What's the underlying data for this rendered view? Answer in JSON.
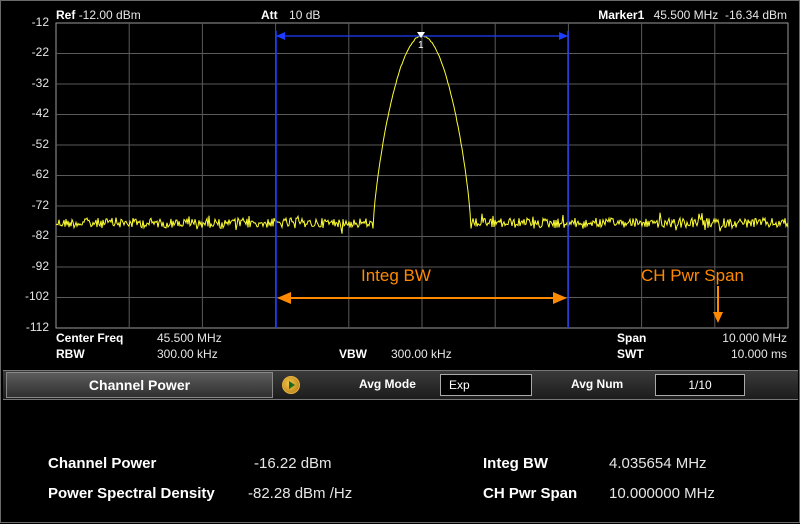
{
  "header": {
    "ref_key": "Ref",
    "ref_value": "-12.00 dBm",
    "att_key": "Att",
    "att_value": "10 dB",
    "marker_key": "Marker1",
    "marker_value": "45.500 MHz  -16.34 dBm"
  },
  "y_axis": {
    "ticks": [
      "-12",
      "-22",
      "-32",
      "-42",
      "-52",
      "-62",
      "-72",
      "-82",
      "-92",
      "-102",
      "-112"
    ]
  },
  "plot": {
    "marker_label": "1",
    "integ_bw_label": "Integ BW",
    "ch_pwr_span_label": "CH Pwr Span",
    "colors": {
      "trace": "#ffff33",
      "grid": "#5a5a5a",
      "integ_lines": "#1e3cff",
      "annotation": "#ff8a00"
    }
  },
  "footer": {
    "center_freq_key": "Center Freq",
    "center_freq_value": "45.500 MHz",
    "rbw_key": "RBW",
    "rbw_value": "300.00 kHz",
    "vbw_key": "VBW",
    "vbw_value": "300.00 kHz",
    "span_key": "Span",
    "span_value": "10.000 MHz",
    "swt_key": "SWT",
    "swt_value": "10.000 ms"
  },
  "panel": {
    "title": "Channel Power",
    "avg_mode_label": "Avg Mode",
    "avg_mode_value": "Exp",
    "avg_num_label": "Avg  Num",
    "avg_num_value": "1/10"
  },
  "results": {
    "channel_power_label": "Channel Power",
    "channel_power_value": "-16.22 dBm",
    "psd_label": "Power Spectral Density",
    "psd_value": "-82.28 dBm /Hz",
    "integ_bw_label": "Integ BW",
    "integ_bw_value": "4.035654 MHz",
    "ch_pwr_span_label": "CH Pwr Span",
    "ch_pwr_span_value": "10.000000 MHz"
  }
}
